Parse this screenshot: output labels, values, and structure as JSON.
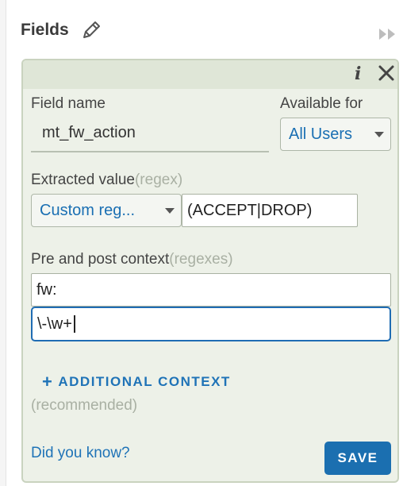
{
  "header": {
    "title": "Fields"
  },
  "panel": {
    "field_name": {
      "label": "Field name",
      "value": "mt_fw_action"
    },
    "available_for": {
      "label": "Available for",
      "selected": "All Users"
    },
    "extracted_value": {
      "label": "Extracted value",
      "hint": "(regex)",
      "type_selected": "Custom reg...",
      "regex": "(ACCEPT|DROP)"
    },
    "context": {
      "label": "Pre and post context",
      "hint": "(regexes)",
      "pre": "fw:",
      "post": "\\-\\w+"
    },
    "additional_context": {
      "label": "ADDITIONAL CONTEXT",
      "hint": "(recommended)"
    },
    "footer": {
      "did_you_know": "Did you know?",
      "save_label": "SAVE"
    }
  },
  "colors": {
    "accent": "#1b6fb0",
    "panel_bg": "#edf1e8",
    "focus_border": "#1f6cb3"
  },
  "icons": [
    "pencil-icon",
    "collapse-panel-icon",
    "info-icon",
    "close-icon",
    "dropdown-caret-icon",
    "plus-icon"
  ]
}
